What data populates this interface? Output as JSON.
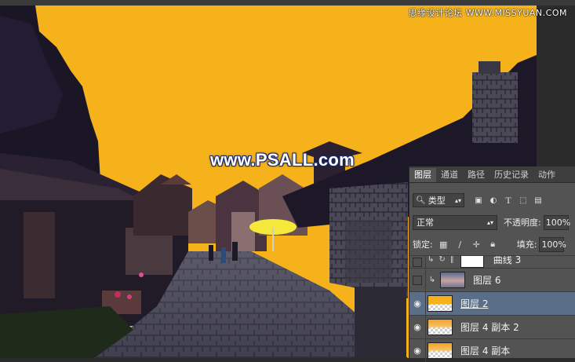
{
  "watermark": {
    "top_right": "思缘设计论坛 WWW.MISSYUAN.COM",
    "center": "www.PSALL.com"
  },
  "layers_panel": {
    "tabs": [
      {
        "label": "图层",
        "active": true
      },
      {
        "label": "通道"
      },
      {
        "label": "路径"
      },
      {
        "label": "历史记录"
      },
      {
        "label": "动作"
      }
    ],
    "filter": {
      "kind_label": "类型",
      "icons": [
        "image-filter-icon",
        "adjustment-filter-icon",
        "type-filter-icon",
        "shape-filter-icon",
        "smart-object-filter-icon"
      ]
    },
    "blend_mode": "正常",
    "opacity_label": "不透明度:",
    "opacity_value": "100%",
    "lock_label": "锁定:",
    "fill_label": "填充:",
    "fill_value": "100%",
    "layers": [
      {
        "name": "曲线 3",
        "visible": false,
        "clipped": true,
        "kind": "adjustment"
      },
      {
        "name": "图层 6",
        "visible": false,
        "clipped": true,
        "thumb": "sky"
      },
      {
        "name": "图层 2",
        "visible": true,
        "selected": true,
        "thumb": "yellow"
      },
      {
        "name": "图层 4 副本 2",
        "visible": true,
        "thumb": "orange"
      },
      {
        "name": "图层 4 副本",
        "visible": true,
        "thumb": "orange"
      }
    ]
  },
  "colors": {
    "sky_yellow": "#f6b21a",
    "panel_bg": "#535353",
    "selected_row": "#5a6e87"
  }
}
